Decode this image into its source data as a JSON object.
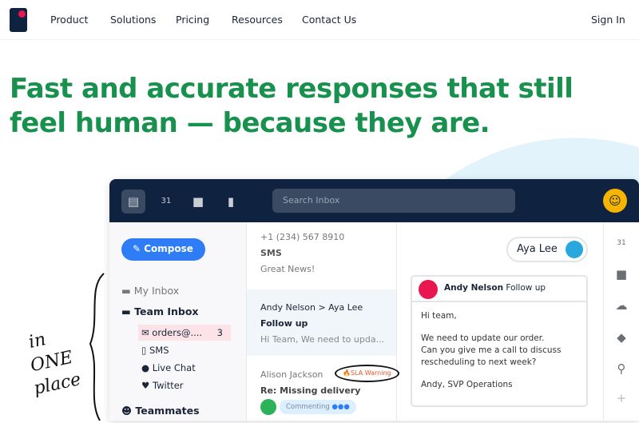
{
  "nav": {
    "items": [
      "Product",
      "Solutions",
      "Pricing",
      "Resources",
      "Contact Us"
    ],
    "sign_in": "Sign In"
  },
  "hero": {
    "line1": "Fast and accurate responses that still",
    "line2": "feel human — because they are."
  },
  "annotation": {
    "line1": "in",
    "line2": "ONE",
    "line3": "place"
  },
  "app": {
    "search_placeholder": "Search Inbox",
    "calendar_day": "31",
    "sidebar": {
      "compose": "Compose",
      "my_inbox": "My Inbox",
      "team_inbox": "Team Inbox",
      "channels": [
        {
          "label": "orders@....",
          "count": "3"
        },
        {
          "label": "SMS"
        },
        {
          "label": "Live Chat"
        },
        {
          "label": "Twitter"
        }
      ],
      "teammates": "Teammates"
    },
    "conversations": [
      {
        "from": "+1 (234) 567 8910",
        "subject": "SMS",
        "preview": "Great News!"
      },
      {
        "from": "Andy Nelson > Aya Lee",
        "subject": "Follow up",
        "preview": "Hi Team, We need to upda..."
      },
      {
        "from": "Alison Jackson",
        "badge": "SLA Warning",
        "subject": "Re: Missing delivery",
        "status": "Commenting"
      }
    ],
    "detail": {
      "assignee": "Aya Lee",
      "sender": "Andy Nelson",
      "subject": "Follow up",
      "body": [
        "Hi team,",
        "We need to update our order.",
        "Can you give me a call to discuss",
        "rescheduling to next week?",
        "Andy, SVP Operations"
      ]
    },
    "colors": {
      "brand_green": "#17914d",
      "header": "#0f2340",
      "compose": "#2e7cf6",
      "sla": "#e8542a"
    }
  }
}
